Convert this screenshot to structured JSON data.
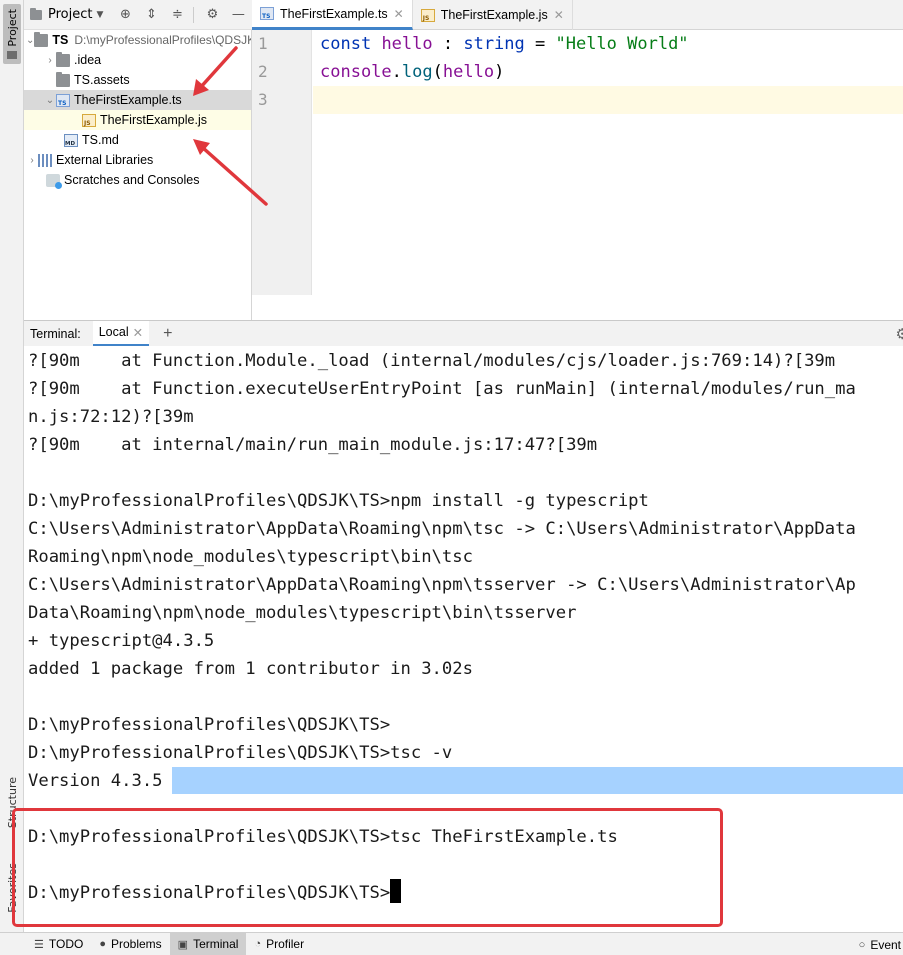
{
  "left_stripe": {
    "project_label": "Project",
    "structure_label": "Structure",
    "favorites_label": "Favorites"
  },
  "project_panel": {
    "title": "Project",
    "tree": {
      "root_name": "TS",
      "root_path": "D:\\myProfessionalProfiles\\QDSJK\\TS",
      "items": [
        {
          "label": ".idea",
          "icon": "folder-icon"
        },
        {
          "label": "TS.assets",
          "icon": "folder-icon"
        },
        {
          "label": "TheFirstExample.ts",
          "icon": "typescript-file-icon"
        },
        {
          "label": "TheFirstExample.js",
          "icon": "javascript-file-icon"
        },
        {
          "label": "TS.md",
          "icon": "markdown-file-icon"
        },
        {
          "label": "External Libraries",
          "icon": "library-icon"
        },
        {
          "label": "Scratches and Consoles",
          "icon": "scratch-icon"
        }
      ]
    }
  },
  "editor": {
    "tabs": [
      {
        "label": "TheFirstExample.ts",
        "active": true
      },
      {
        "label": "TheFirstExample.js",
        "active": false
      }
    ],
    "line_numbers": [
      "1",
      "2",
      "3"
    ],
    "code": {
      "line1": {
        "kw": "const",
        "var": "hello",
        "sep": " : ",
        "type": "string",
        "eq": " = ",
        "str": "\"Hello World\""
      },
      "line2": {
        "obj": "console",
        "dot": ".",
        "method": "log",
        "open": "(",
        "arg": "hello",
        "close": ")"
      }
    }
  },
  "terminal": {
    "label": "Terminal:",
    "tab": "Local",
    "lines": [
      "?[90m    at Function.Module._load (internal/modules/cjs/loader.js:769:14)?[39m",
      "?[90m    at Function.executeUserEntryPoint [as runMain] (internal/modules/run_ma",
      "n.js:72:12)?[39m",
      "?[90m    at internal/main/run_main_module.js:17:47?[39m",
      "",
      "D:\\myProfessionalProfiles\\QDSJK\\TS>npm install -g typescript",
      "C:\\Users\\Administrator\\AppData\\Roaming\\npm\\tsc -> C:\\Users\\Administrator\\AppData",
      "Roaming\\npm\\node_modules\\typescript\\bin\\tsc",
      "C:\\Users\\Administrator\\AppData\\Roaming\\npm\\tsserver -> C:\\Users\\Administrator\\Ap",
      "Data\\Roaming\\npm\\node_modules\\typescript\\bin\\tsserver",
      "+ typescript@4.3.5",
      "added 1 package from 1 contributor in 3.02s",
      "",
      "D:\\myProfessionalProfiles\\QDSJK\\TS>",
      "D:\\myProfessionalProfiles\\QDSJK\\TS>tsc -v",
      "Version 4.3.5",
      "",
      "D:\\myProfessionalProfiles\\QDSJK\\TS>tsc TheFirstExample.ts",
      "",
      "D:\\myProfessionalProfiles\\QDSJK\\TS>"
    ]
  },
  "status_bar": {
    "todo": "TODO",
    "problems": "Problems",
    "terminal": "Terminal",
    "profiler": "Profiler",
    "event_log": "Event"
  },
  "colors": {
    "annotation": "#e0373c",
    "selection_highlight": "#a6d2ff",
    "keyword": "#0033b3",
    "string": "#067d17",
    "variable": "#871094"
  }
}
